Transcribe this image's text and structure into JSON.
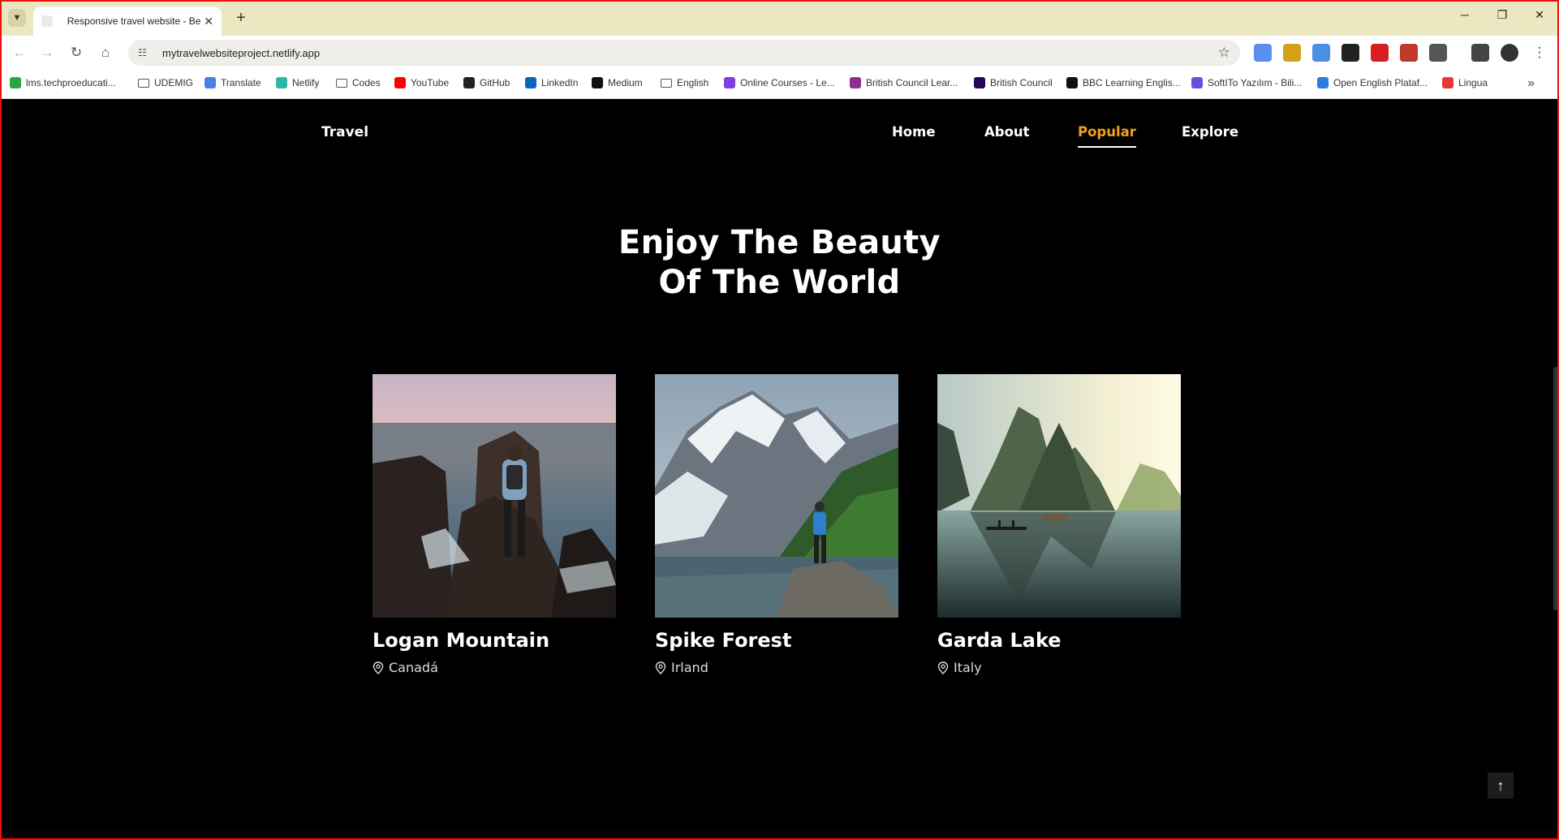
{
  "browser": {
    "tab_title": "Responsive travel website - Bec",
    "new_tab": "+",
    "url": "mytravelwebsiteproject.netlify.app",
    "bookmarks": [
      {
        "label": "lms.techproeducati...",
        "color": "#28a745"
      },
      {
        "label": "UDEMIG",
        "color": "folder"
      },
      {
        "label": "Translate",
        "color": "#4a7fe8"
      },
      {
        "label": "Netlify",
        "color": "#2fb5a6"
      },
      {
        "label": "Codes",
        "color": "folder"
      },
      {
        "label": "YouTube",
        "color": "#ff0000"
      },
      {
        "label": "GitHub",
        "color": "#222222"
      },
      {
        "label": "LinkedIn",
        "color": "#0a66c2"
      },
      {
        "label": "Medium",
        "color": "#111111"
      },
      {
        "label": "English",
        "color": "folder"
      },
      {
        "label": "Online Courses - Le...",
        "color": "#7b3fe4"
      },
      {
        "label": "British Council Lear...",
        "color": "#8e2f8e"
      },
      {
        "label": "British Council",
        "color": "#23085a"
      },
      {
        "label": "BBC Learning Englis...",
        "color": "#111111"
      },
      {
        "label": "SoftITo Yazılım - Bili...",
        "color": "#6a4ee0"
      },
      {
        "label": "Open English Plataf...",
        "color": "#2b7be0"
      },
      {
        "label": "Lingua",
        "color": "#e53935"
      }
    ]
  },
  "site": {
    "logo": "Travel",
    "nav": [
      "Home",
      "About",
      "Popular",
      "Explore"
    ],
    "active_nav": "Popular",
    "hero_line1": "Enjoy The Beauty",
    "hero_line2": "Of The World",
    "cards": [
      {
        "title": "Logan Mountain",
        "location": "Canadá"
      },
      {
        "title": "Spike Forest",
        "location": "Irland"
      },
      {
        "title": "Garda Lake",
        "location": "Italy"
      }
    ],
    "accent_color": "#f0a21c"
  }
}
